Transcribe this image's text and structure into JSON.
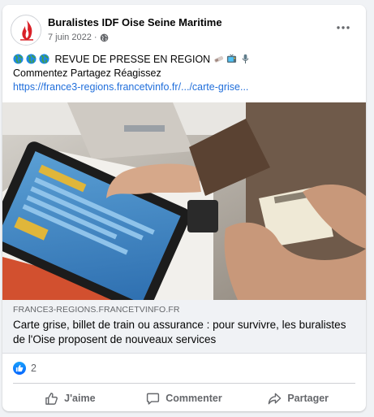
{
  "post": {
    "author": "Buralistes IDF Oise Seine Maritime",
    "date": "7 juin 2022",
    "separator": "·",
    "privacy_icon": "globe-icon",
    "more_icon": "ellipsis-icon",
    "text_line1": "REVUE DE PRESSE EN REGION",
    "text_line2": "Commentez Partagez Réagissez",
    "link_text": "https://france3-regions.francetvinfo.fr/.../carte-grise...",
    "leading_emojis": [
      "globe-emoji",
      "globe-emoji",
      "globe-emoji"
    ],
    "trailing_emojis": [
      "newspaper-emoji",
      "tv-emoji",
      "microphone-emoji"
    ]
  },
  "preview": {
    "domain": "FRANCE3-REGIONS.FRANCETVINFO.FR",
    "headline": "Carte grise, billet de train ou assurance : pour survivre, les buralistes de l'Oise proposent de nouveaux services"
  },
  "reactions": {
    "icon": "like-icon",
    "count": "2"
  },
  "actions": {
    "like": "J'aime",
    "comment": "Commenter",
    "share": "Partager"
  },
  "colors": {
    "link": "#216fdb",
    "like_blue": "#0866ff",
    "muted_text": "#65676b",
    "background": "#f0f2f5"
  }
}
